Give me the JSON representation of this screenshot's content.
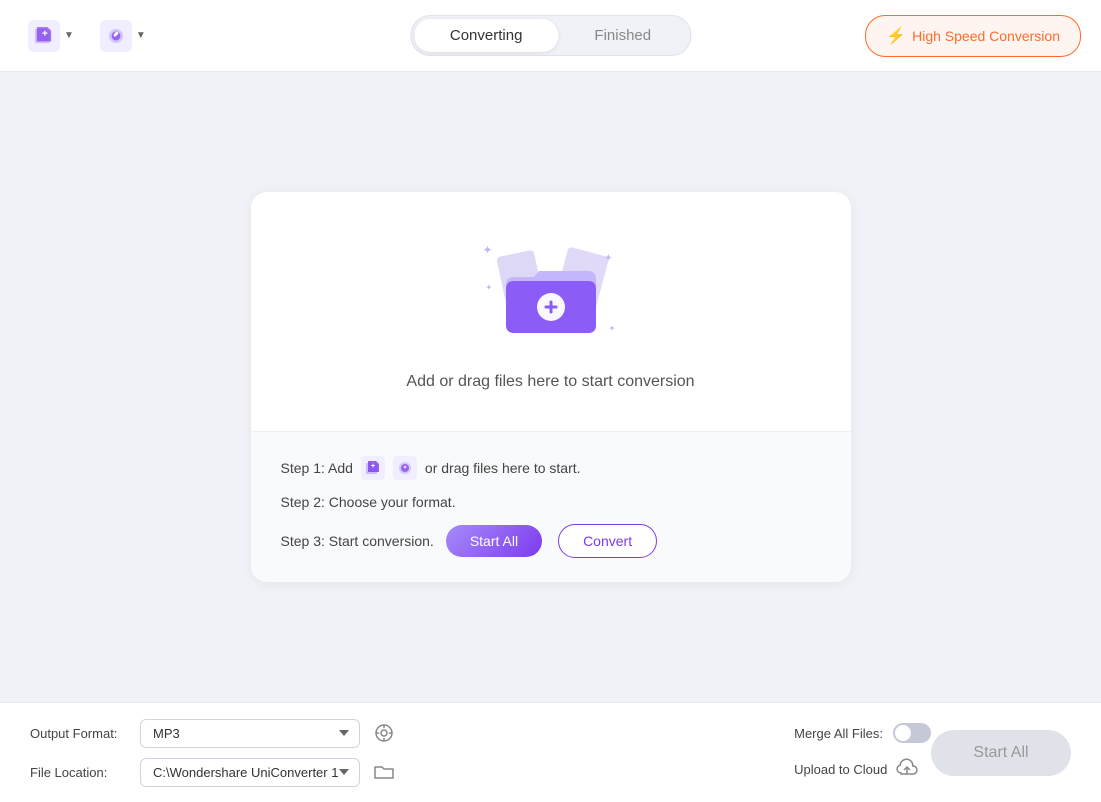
{
  "header": {
    "tab_converting": "Converting",
    "tab_finished": "Finished",
    "speed_btn_label": "High Speed Conversion",
    "active_tab": "converting"
  },
  "toolbar": {
    "start_all_label": "Start All",
    "convert_label": "Convert"
  },
  "dropzone": {
    "instruction_text": "Add or drag files here to start conversion"
  },
  "steps": {
    "step1_prefix": "Step 1: Add",
    "step1_suffix": "or drag files here to start.",
    "step2": "Step 2: Choose your format.",
    "step3_prefix": "Step 3: Start conversion."
  },
  "bottom": {
    "output_format_label": "Output Format:",
    "output_format_value": "MP3",
    "file_location_label": "File Location:",
    "file_location_value": "C:\\Wondershare UniConverter 1",
    "merge_label": "Merge All Files:",
    "upload_label": "Upload to Cloud",
    "start_all_label": "Start All"
  }
}
